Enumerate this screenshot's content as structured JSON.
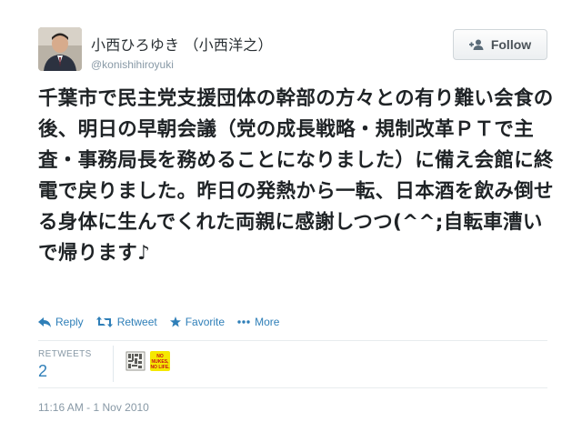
{
  "user": {
    "full_name": "小西ひろゆき （小西洋之）",
    "screen_name": "@konishihiroyuki",
    "avatar": "profile-photo"
  },
  "follow_button": {
    "label": "Follow",
    "icon": "add-person-icon"
  },
  "tweet": {
    "text": "千葉市で民主党支援団体の幹部の方々との有り難い会食の後、明日の早朝会議（党の成長戦略・規制改革ＰＴで主査・事務局長を務めることになりました）に備え会館に終電で戻りました。昨日の発熱から一転、日本酒を飲み倒せる身体に生んでくれた両親に感謝しつつ(^^;自転車漕いで帰ります♪"
  },
  "actions": {
    "reply": "Reply",
    "retweet": "Retweet",
    "favorite": "Favorite",
    "more": "More"
  },
  "stats": {
    "retweets_label": "RETWEETS",
    "retweets_count": "2",
    "retweeter_avatars": [
      {
        "name": "retweeter-avatar-1",
        "text": ""
      },
      {
        "name": "retweeter-avatar-2",
        "text": "NO NUKES, NO LIFE."
      }
    ]
  },
  "timestamp": "11:16 AM - 1 Nov 2010",
  "colors": {
    "link": "#2f7fb8",
    "muted": "#8899a6",
    "text": "#292f33"
  }
}
